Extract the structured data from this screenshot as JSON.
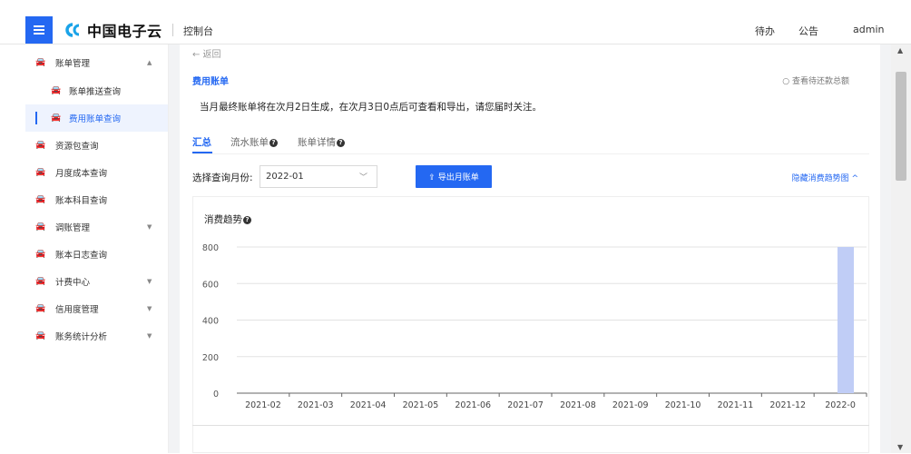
{
  "header": {
    "brand": "中国电子云",
    "console": "控制台",
    "todo": "待办",
    "notice": "公告",
    "user": "admin"
  },
  "sidebar": {
    "items": [
      {
        "label": "账单管理",
        "icon": "car-icon",
        "arrow": "▲"
      },
      {
        "label": "账单推送查询",
        "icon": "car-icon"
      },
      {
        "label": "费用账单查询",
        "icon": "car-icon"
      },
      {
        "label": "资源包查询",
        "icon": "car-icon"
      },
      {
        "label": "月度成本查询",
        "icon": "car-icon"
      },
      {
        "label": "账本科目查询",
        "icon": "car-icon"
      },
      {
        "label": "调账管理",
        "icon": "car-icon",
        "arrow": "▼"
      },
      {
        "label": "账本日志查询",
        "icon": "car-icon"
      },
      {
        "label": "计费中心",
        "icon": "car-icon",
        "arrow": "▼"
      },
      {
        "label": "信用度管理",
        "icon": "car-icon",
        "arrow": "▼"
      },
      {
        "label": "账务统计分析",
        "icon": "car-icon",
        "arrow": "▼"
      }
    ]
  },
  "main": {
    "back": "← 返回",
    "title": "费用账单",
    "view_total": "○ 查看待还款总额",
    "notice_text": "当月最终账单将在次月2日生成，在次月3日0点后可查看和导出，请您届时关注。",
    "tabs": [
      {
        "label": "汇总"
      },
      {
        "label": "流水账单"
      },
      {
        "label": "账单详情"
      }
    ],
    "month_label": "选择查询月份:",
    "month_value": "2022-01",
    "export_label": "⇪ 导出月账单",
    "hide_trend": "隐藏消费趋势图 ^",
    "chart_title": "消费趋势"
  },
  "colors": {
    "accent": "#2468f2",
    "bar": "#c0cdf6"
  },
  "chart_data": {
    "type": "bar",
    "title": "消费趋势",
    "categories": [
      "2021-02",
      "2021-03",
      "2021-04",
      "2021-05",
      "2021-06",
      "2021-07",
      "2021-08",
      "2021-09",
      "2021-10",
      "2021-11",
      "2021-12",
      "2022-0"
    ],
    "values": [
      0,
      0,
      0,
      0,
      0,
      0,
      0,
      0,
      0,
      0,
      0,
      800
    ],
    "yticks": [
      0,
      200,
      400,
      600,
      800
    ],
    "ylim": [
      0,
      800
    ],
    "grid": true
  }
}
